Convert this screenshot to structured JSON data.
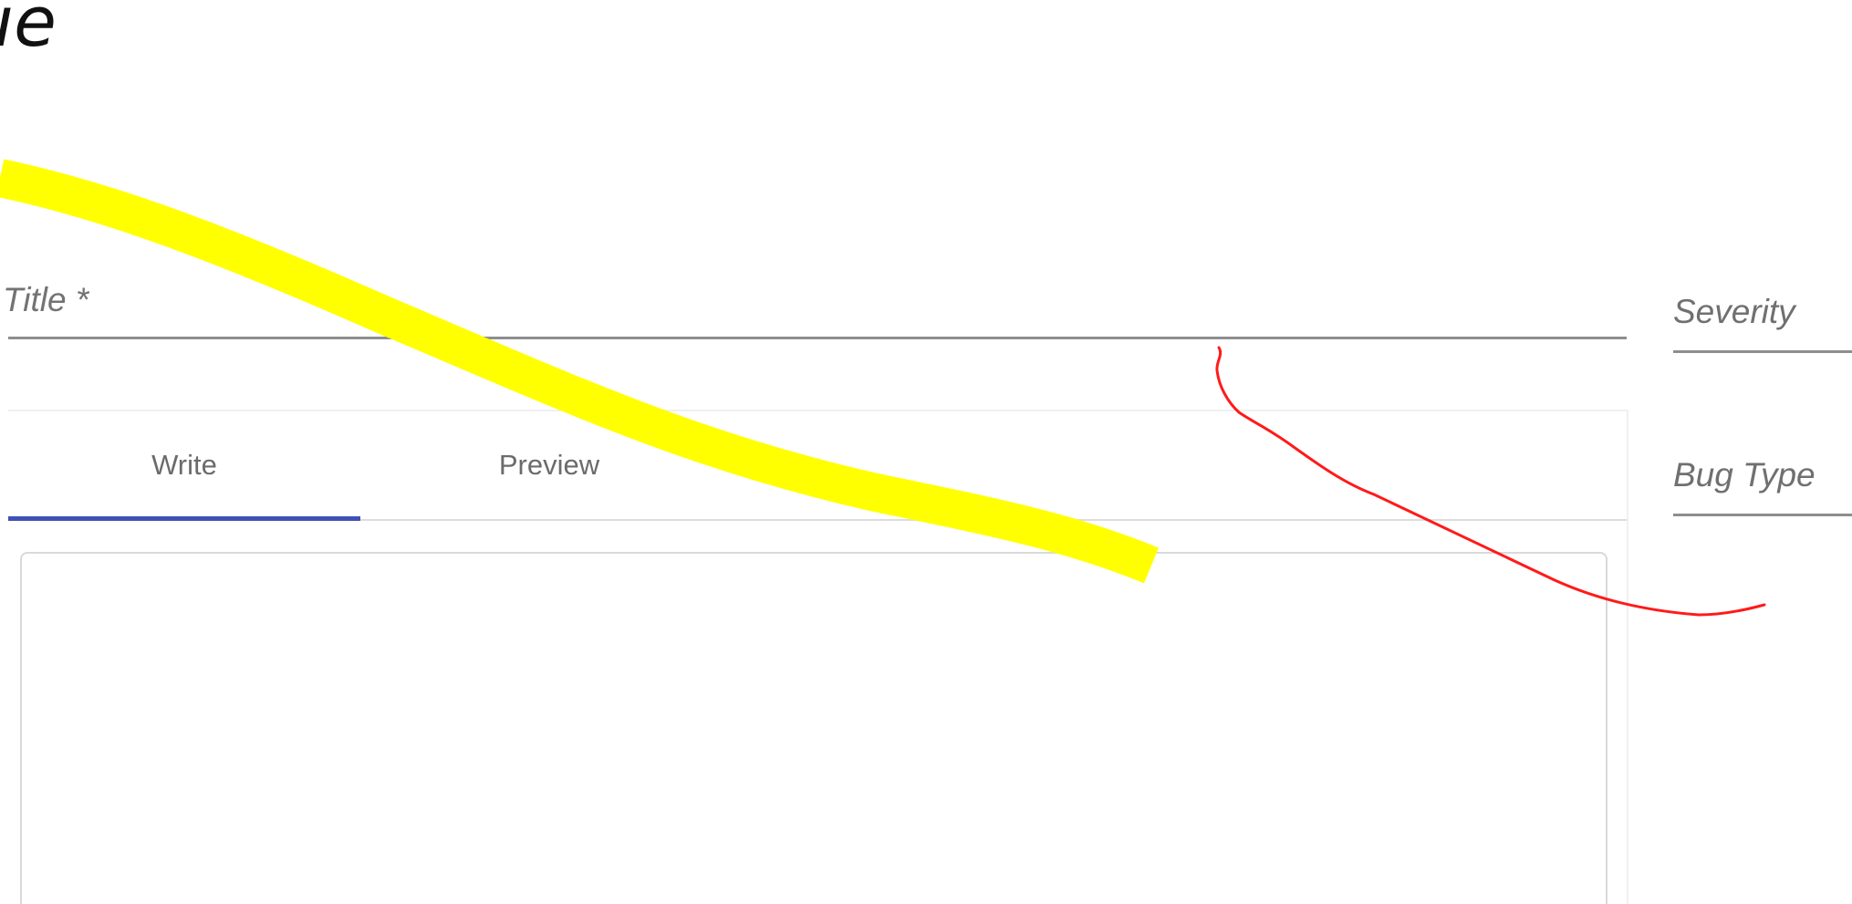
{
  "page": {
    "heading_fragment": "ıe"
  },
  "form": {
    "title": {
      "label": "Title *",
      "value": ""
    },
    "editor": {
      "tabs": [
        {
          "label": "Write",
          "selected": true
        },
        {
          "label": "Preview",
          "selected": false
        }
      ],
      "body_value": ""
    },
    "side_fields": {
      "severity": {
        "label": "Severity",
        "value": ""
      },
      "bug_type": {
        "label": "Bug Type",
        "value": ""
      }
    }
  },
  "colors": {
    "tab_indicator": "#3f51b5",
    "yellow_markup": "#ffff00",
    "red_markup": "#ff1a1a",
    "label_gray": "#737373"
  }
}
